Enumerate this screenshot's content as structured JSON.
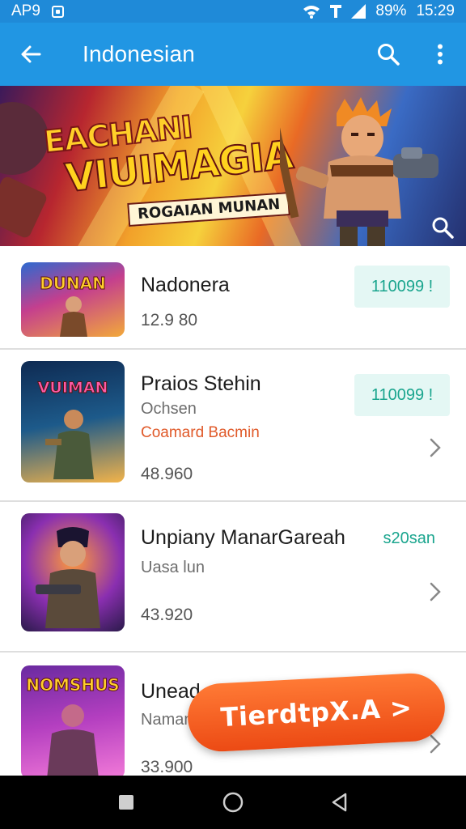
{
  "status_bar": {
    "left_text": "AP9",
    "battery": "89%",
    "time": "15:29"
  },
  "app_bar": {
    "title": "Indonesian",
    "icons": [
      "back-arrow-icon",
      "search-icon",
      "more-vert-icon"
    ]
  },
  "banner": {
    "line1": "EACHANI",
    "line2": "VIUIMAGIA",
    "subtitle": "ROGAIAN MUNAN"
  },
  "list": {
    "items": [
      {
        "thumb_text": "DUNAN",
        "title": "Nadonera",
        "value": "12.9 80",
        "price": "110099 !"
      },
      {
        "thumb_text": "VUIMAN",
        "title": "Praios Stehin",
        "subtitle": "Ochsen",
        "accent": "Coamard Bacmin",
        "value": "48.960",
        "price": "110099 !"
      },
      {
        "thumb_text": "",
        "title": "Unpiany ManarGareah",
        "tag": "s20san",
        "subtitle": "Uasa lun",
        "value": "43.920"
      },
      {
        "thumb_text": "NOMSHUS",
        "title": "Unead",
        "subtitle": "Naman",
        "value": "33.900"
      }
    ]
  },
  "fab": {
    "label": "TierdtpX.A >"
  },
  "nav_bar": {
    "icons": [
      "recents-square-icon",
      "home-circle-icon",
      "back-triangle-icon"
    ]
  },
  "colors": {
    "app_bar": "#2196e3",
    "status_bar": "#1f8ad8",
    "price_text": "#1aa58e",
    "price_bg": "#e4f7f4",
    "fab": "#ec4a14"
  }
}
